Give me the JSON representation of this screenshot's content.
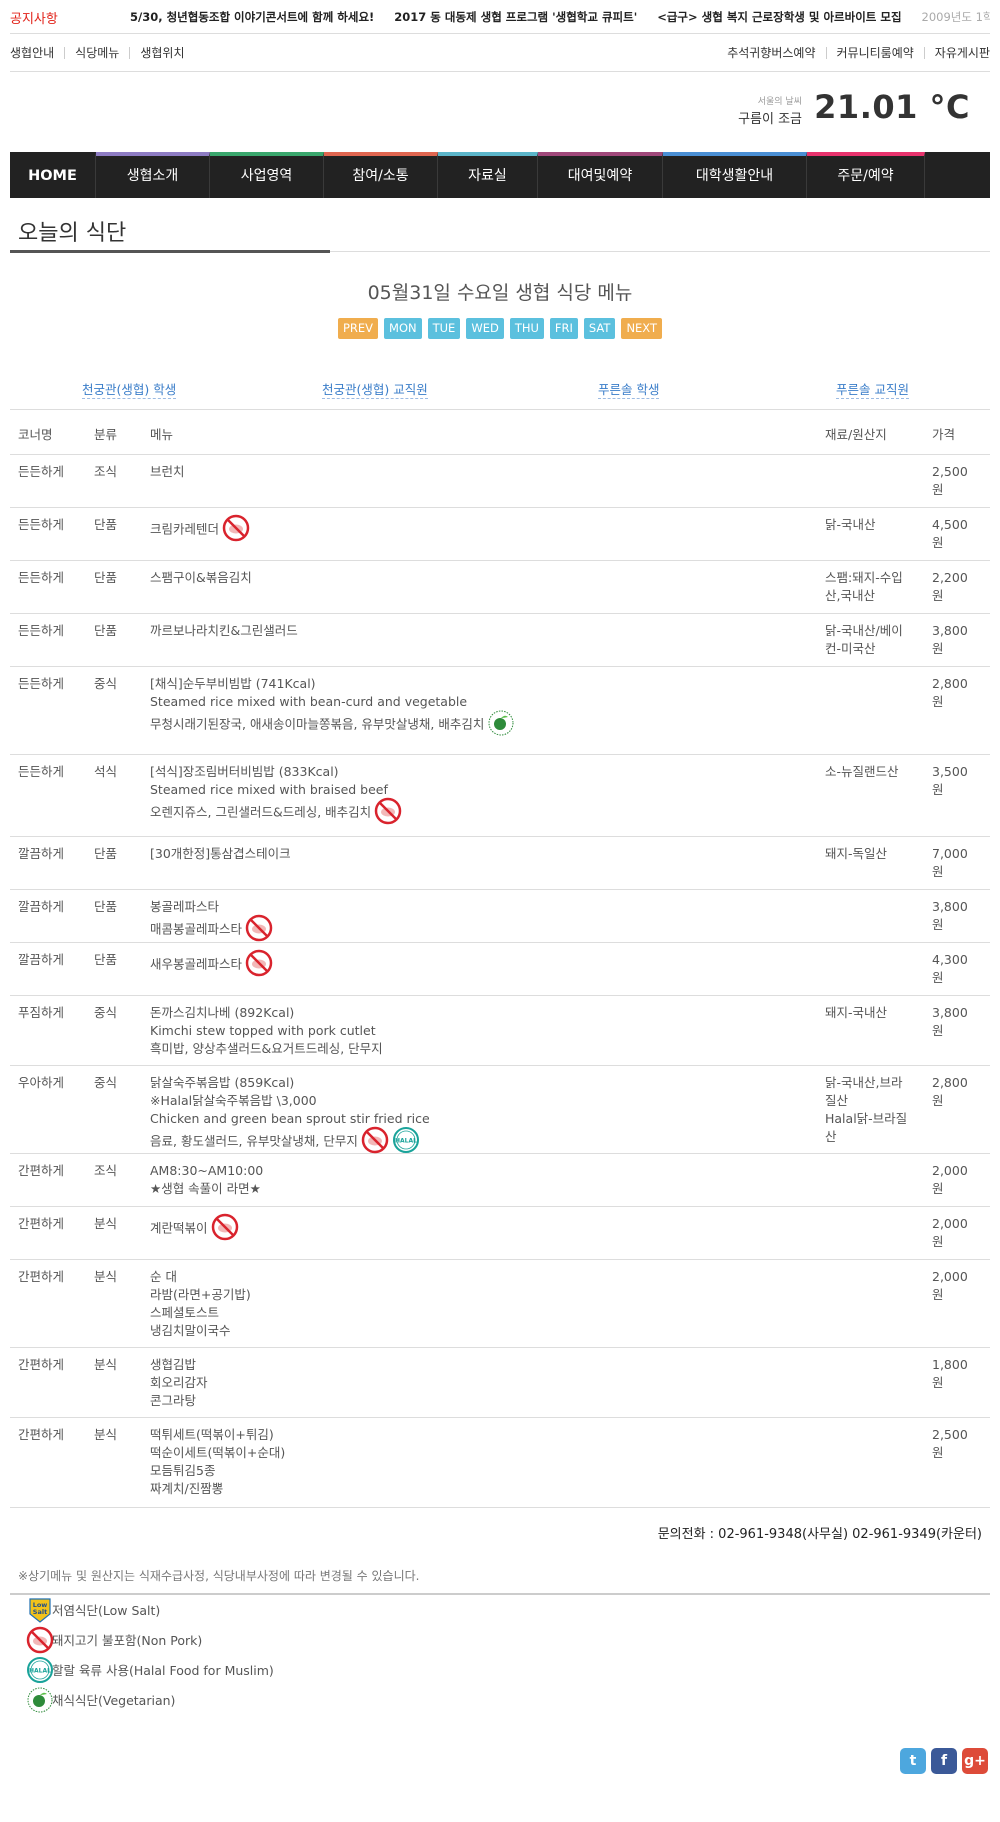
{
  "notice": {
    "label": "공지사항",
    "items": [
      "5/30, 청년협동조합 이야기콘서트에 함께 하세요!",
      "2017 동 대동제 생협 프로그램 '생협학교 큐피트'",
      "<급구> 생협 복지 근로장학생 및 아르바이트 모집"
    ],
    "date": "2009년도 1학"
  },
  "util": {
    "left": [
      "생협안내",
      "식당메뉴",
      "생협위치"
    ],
    "right": [
      "추석귀향버스예약",
      "커뮤니티룸예약",
      "자유게시판"
    ]
  },
  "weather": {
    "label": "서울의 날씨",
    "condition": "구름이 조금",
    "temp": "21.01 °C"
  },
  "nav": [
    {
      "label": "HOME",
      "color": "#222222"
    },
    {
      "label": "생협소개",
      "color": "#8e7cc3"
    },
    {
      "label": "사업영역",
      "color": "#3aa76d"
    },
    {
      "label": "참여/소통",
      "color": "#e06650"
    },
    {
      "label": "자료실",
      "color": "#5bb5c9"
    },
    {
      "label": "대여및예약",
      "color": "#a0487a"
    },
    {
      "label": "대학생활안내",
      "color": "#4a8fd4"
    },
    {
      "label": "주문/예약",
      "color": "#e8336d"
    }
  ],
  "page_title": "오늘의 식단",
  "menu_title": "05월31일 수요일 생협 식당 메뉴",
  "days": [
    "PREV",
    "MON",
    "TUE",
    "WED",
    "THU",
    "FRI",
    "SAT",
    "NEXT"
  ],
  "cafes": [
    "천궁관(생협) 학생",
    "천궁관(생협) 교직원",
    "푸른솔 학생",
    "푸른솔 교직원"
  ],
  "table": {
    "headers": [
      "코너명",
      "분류",
      "메뉴",
      "재료/원산지",
      "가격"
    ],
    "rows": [
      {
        "corner": "든든하게",
        "type": "조식",
        "menu": [
          "브런치"
        ],
        "origin": [],
        "price": [
          "2,500",
          "원"
        ],
        "icons": []
      },
      {
        "corner": "든든하게",
        "type": "단품",
        "menu": [
          "크림카레텐더"
        ],
        "origin": [
          "닭-국내산"
        ],
        "price": [
          "4,500",
          "원"
        ],
        "icons": [
          "nopork"
        ]
      },
      {
        "corner": "든든하게",
        "type": "단품",
        "menu": [
          "스팸구이&볶음김치"
        ],
        "origin": [
          "스팸:돼지-수입",
          "산,국내산"
        ],
        "price": [
          "2,200",
          "원"
        ],
        "icons": []
      },
      {
        "corner": "든든하게",
        "type": "단품",
        "menu": [
          "까르보나라치킨&그린샐러드"
        ],
        "origin": [
          "닭-국내산/베이",
          "컨-미국산"
        ],
        "price": [
          "3,800",
          "원"
        ],
        "icons": []
      },
      {
        "corner": "든든하게",
        "type": "중식",
        "menu": [
          "[채식]순두부비빔밥 (741Kcal)",
          "Steamed rice mixed with bean-curd and vegetable",
          "무청시래기된장국, 애새송이마늘쫑볶음, 유부맛살냉채, 배추김치"
        ],
        "origin": [],
        "price": [
          "2,800",
          "원"
        ],
        "icons": [
          "veg"
        ]
      },
      {
        "corner": "든든하게",
        "type": "석식",
        "menu": [
          "[석식]장조림버터비빔밥 (833Kcal)",
          "Steamed rice mixed with braised beef",
          "오렌지쥬스, 그린샐러드&드레싱, 배추김치"
        ],
        "origin": [
          "소-뉴질랜드산"
        ],
        "price": [
          "3,500",
          "원"
        ],
        "icons": [
          "nopork"
        ]
      },
      {
        "corner": "깔끔하게",
        "type": "단품",
        "menu": [
          "[30개한정]통삼겹스테이크"
        ],
        "origin": [
          "돼지-독일산"
        ],
        "price": [
          "7,000",
          "원"
        ],
        "icons": []
      },
      {
        "corner": "깔끔하게",
        "type": "단품",
        "menu": [
          "봉골레파스타",
          "매콤봉골레파스타"
        ],
        "origin": [],
        "price": [
          "3,800",
          "원"
        ],
        "icons": [
          "nopork"
        ]
      },
      {
        "corner": "깔끔하게",
        "type": "단품",
        "menu": [
          "새우봉골레파스타"
        ],
        "origin": [],
        "price": [
          "4,300",
          "원"
        ],
        "icons": [
          "nopork"
        ]
      },
      {
        "corner": "푸짐하게",
        "type": "중식",
        "menu": [
          "돈까스김치나베 (892Kcal)",
          "Kimchi stew topped with pork cutlet",
          "흑미밥, 양상추샐러드&요거트드레싱, 단무지"
        ],
        "origin": [
          "돼지-국내산"
        ],
        "price": [
          "3,800",
          "원"
        ],
        "icons": []
      },
      {
        "corner": "우아하게",
        "type": "중식",
        "menu": [
          "닭살숙주볶음밥 (859Kcal)",
          "※Halal닭살숙주볶음밥 \\3,000",
          "Chicken and green bean sprout stir fried rice",
          "음료, 황도샐러드, 유부맛살냉채, 단무지"
        ],
        "origin": [
          "닭-국내산,브라",
          "질산",
          "Halal닭-브라질",
          "산"
        ],
        "price": [
          "2,800",
          "원"
        ],
        "icons": [
          "nopork",
          "halal"
        ]
      },
      {
        "corner": "간편하게",
        "type": "조식",
        "menu": [
          "AM8:30~AM10:00",
          "★생협 속풀이 라면★"
        ],
        "origin": [],
        "price": [
          "2,000",
          "원"
        ],
        "icons": []
      },
      {
        "corner": "간편하게",
        "type": "분식",
        "menu": [
          "계란떡볶이"
        ],
        "origin": [],
        "price": [
          "2,000",
          "원"
        ],
        "icons": [
          "nopork"
        ]
      },
      {
        "corner": "간편하게",
        "type": "분식",
        "menu": [
          "순 대",
          "라밤(라면+공기밥)",
          "스페셜토스트",
          "냉김치말이국수"
        ],
        "origin": [],
        "price": [
          "2,000",
          "원"
        ],
        "icons": []
      },
      {
        "corner": "간편하게",
        "type": "분식",
        "menu": [
          "생협김밥",
          "회오리감자",
          "콘그라탕"
        ],
        "origin": [],
        "price": [
          "1,800",
          "원"
        ],
        "icons": []
      },
      {
        "corner": "간편하게",
        "type": "분식",
        "menu": [
          "떡튀세트(떡볶이+튀김)",
          "떡순이세트(떡볶이+순대)",
          "모듬튀김5종",
          "짜계치/진짬뽕"
        ],
        "origin": [],
        "price": [
          "2,500",
          "원"
        ],
        "icons": []
      }
    ]
  },
  "contact": "문의전화 : 02-961-9348(사무실) 02-961-9349(카운터)",
  "note": "※상기메뉴 및 원산지는 식재수급사정, 식당내부사정에 따라 변경될 수 있습니다.",
  "legend": [
    {
      "icon": "lowsalt",
      "label": "저염식단(Low Salt)"
    },
    {
      "icon": "nopork",
      "label": "돼지고기 불포함(Non Pork)"
    },
    {
      "icon": "halal",
      "label": "할랄 육류 사용(Halal Food for Muslim)"
    },
    {
      "icon": "veg",
      "label": "채식식단(Vegetarian)"
    }
  ],
  "social": [
    {
      "icon": "twitter-icon",
      "glyph": "t",
      "color": "#4da7de"
    },
    {
      "icon": "facebook-icon",
      "glyph": "f",
      "color": "#3b5998"
    },
    {
      "icon": "google-plus-icon",
      "glyph": "g+",
      "color": "#dd4b39"
    }
  ]
}
